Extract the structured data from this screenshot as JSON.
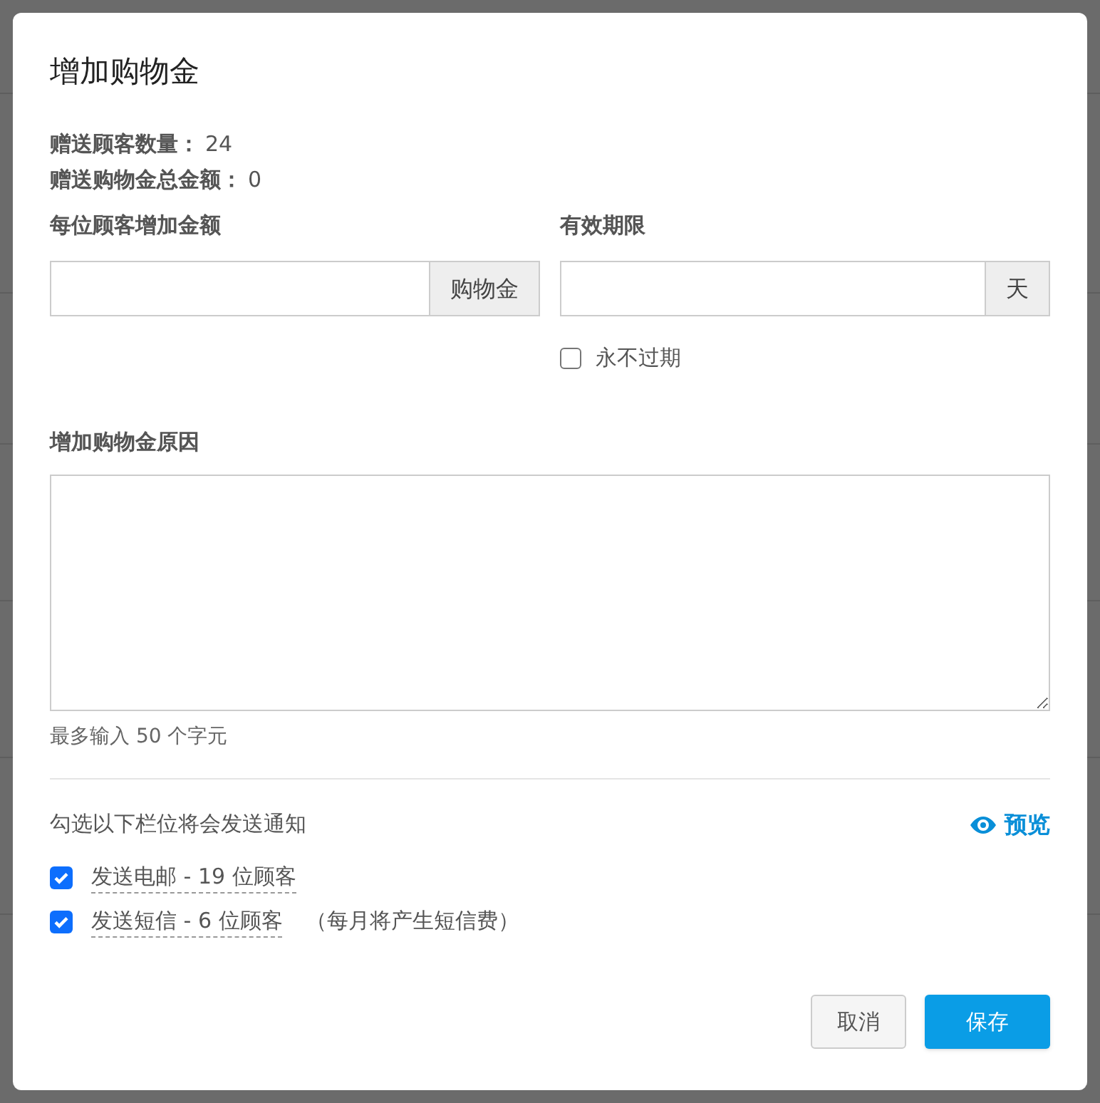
{
  "dialog": {
    "title": "增加购物金",
    "summary": [
      {
        "label": "赠送顾客数量：",
        "value": "24"
      },
      {
        "label": "赠送购物金总金额：",
        "value": "0"
      }
    ],
    "amount_field": {
      "label": "每位顾客增加金额",
      "addon": "购物金"
    },
    "expiry_field": {
      "label": "有效期限",
      "addon": "天"
    },
    "never_expire": {
      "label": "永不过期",
      "checked": false
    },
    "reason": {
      "label": "增加购物金原因",
      "hint": "最多输入 50 个字元"
    },
    "notify": {
      "heading": "勾选以下栏位将会发送通知",
      "preview": "预览",
      "options": [
        {
          "label": "发送电邮 - 19 位顾客",
          "checked": true
        },
        {
          "label": "发送短信 - 6 位顾客",
          "checked": true,
          "note": "（每月将产生短信费）"
        }
      ]
    },
    "buttons": [
      {
        "label": "取消",
        "kind": "secondary"
      },
      {
        "label": "保存",
        "kind": "primary"
      }
    ]
  }
}
